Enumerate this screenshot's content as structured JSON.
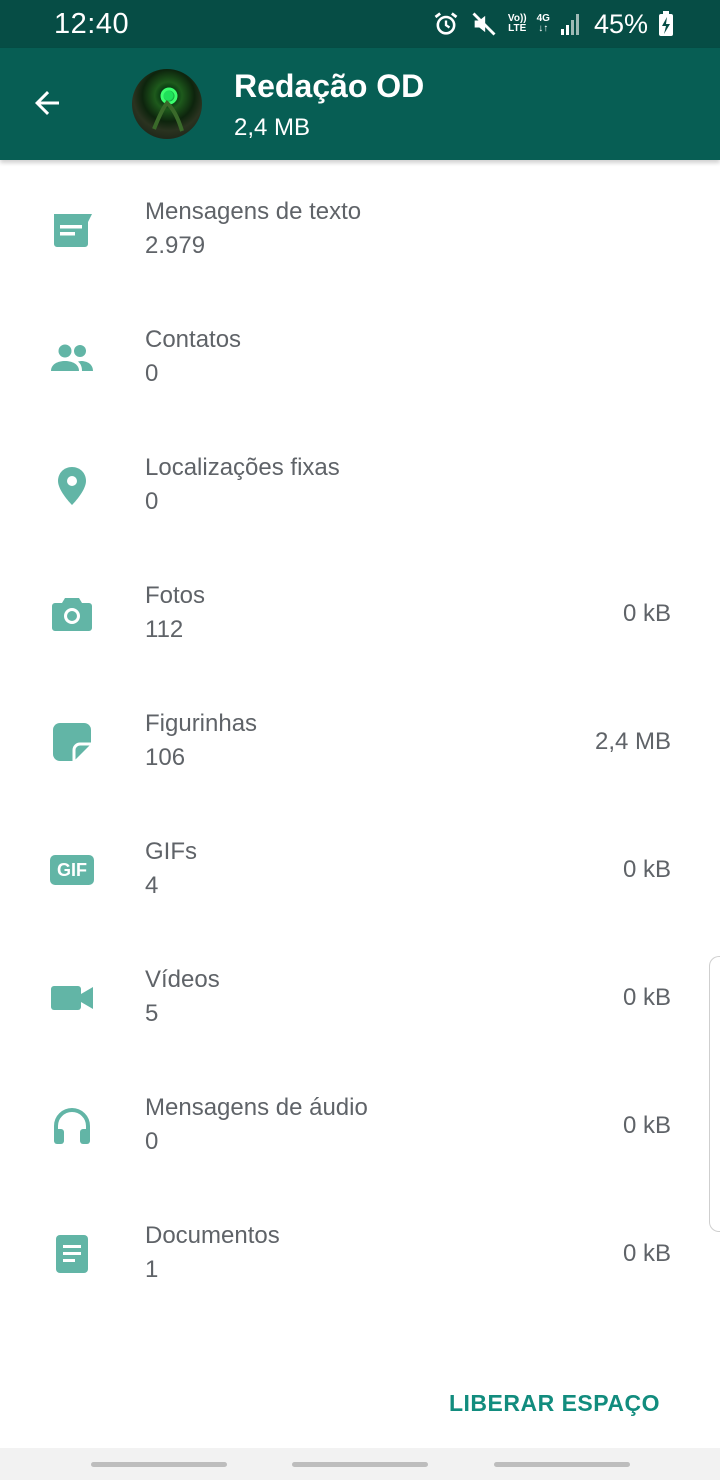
{
  "status_bar": {
    "time": "12:40",
    "volte_top": "Vo))",
    "volte_bottom": "LTE",
    "network": "4G",
    "battery": "45%",
    "icons": [
      "alarm-icon",
      "mute-icon",
      "volte-icon",
      "4g-icon",
      "signal-icon",
      "battery-charging-icon"
    ]
  },
  "header": {
    "title": "Redação OD",
    "subtitle": "2,4 MB",
    "back_icon": "arrow-back-icon"
  },
  "items": [
    {
      "label": "Mensagens de texto",
      "count": "2.979",
      "size": "",
      "icon": "text-message-icon"
    },
    {
      "label": "Contatos",
      "count": "0",
      "size": "",
      "icon": "contacts-icon"
    },
    {
      "label": "Localizações fixas",
      "count": "0",
      "size": "",
      "icon": "location-pin-icon"
    },
    {
      "label": "Fotos",
      "count": "112",
      "size": "0 kB",
      "icon": "camera-icon"
    },
    {
      "label": "Figurinhas",
      "count": "106",
      "size": "2,4 MB",
      "icon": "sticker-icon"
    },
    {
      "label": "GIFs",
      "count": "4",
      "size": "0 kB",
      "icon": "gif-icon"
    },
    {
      "label": "Vídeos",
      "count": "5",
      "size": "0 kB",
      "icon": "video-icon"
    },
    {
      "label": "Mensagens de áudio",
      "count": "0",
      "size": "0 kB",
      "icon": "headphones-icon"
    },
    {
      "label": "Documentos",
      "count": "1",
      "size": "0 kB",
      "icon": "document-icon"
    }
  ],
  "gif_badge_text": "GIF",
  "actions": {
    "free_space": "LIBERAR ESPAÇO"
  },
  "colors": {
    "status_bar": "#064d45",
    "app_bar": "#075e54",
    "icon": "#62b5a6",
    "accent": "#128c7e",
    "text": "#5f6368"
  }
}
